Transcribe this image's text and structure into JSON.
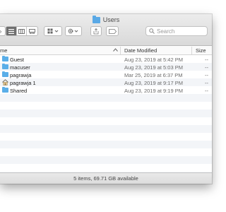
{
  "window": {
    "title": "Users"
  },
  "toolbar": {
    "search_placeholder": "Search"
  },
  "columns": {
    "name": "me",
    "date": "Date Modified",
    "size": "Size"
  },
  "rows": [
    {
      "name": "Guest",
      "date": "Aug 23, 2019 at 5:42 PM",
      "size": "--",
      "icon": "folder-icon"
    },
    {
      "name": "macuser",
      "date": "Aug 23, 2019 at 5:03 PM",
      "size": "--",
      "icon": "folder-icon"
    },
    {
      "name": "pagrawja",
      "date": "Mar 25, 2019 at 6:37 PM",
      "size": "--",
      "icon": "folder-icon"
    },
    {
      "name": "pagrawja 1",
      "date": "Aug 23, 2019 at 9:17 PM",
      "size": "--",
      "icon": "home-folder-icon"
    },
    {
      "name": "Shared",
      "date": "Aug 23, 2019 at 9:19 PM",
      "size": "--",
      "icon": "folder-icon"
    }
  ],
  "status": {
    "text": "5 items, 69.71 GB available"
  },
  "colors": {
    "folder": "#5aaee8",
    "selected_view": "#6e6e6e"
  }
}
